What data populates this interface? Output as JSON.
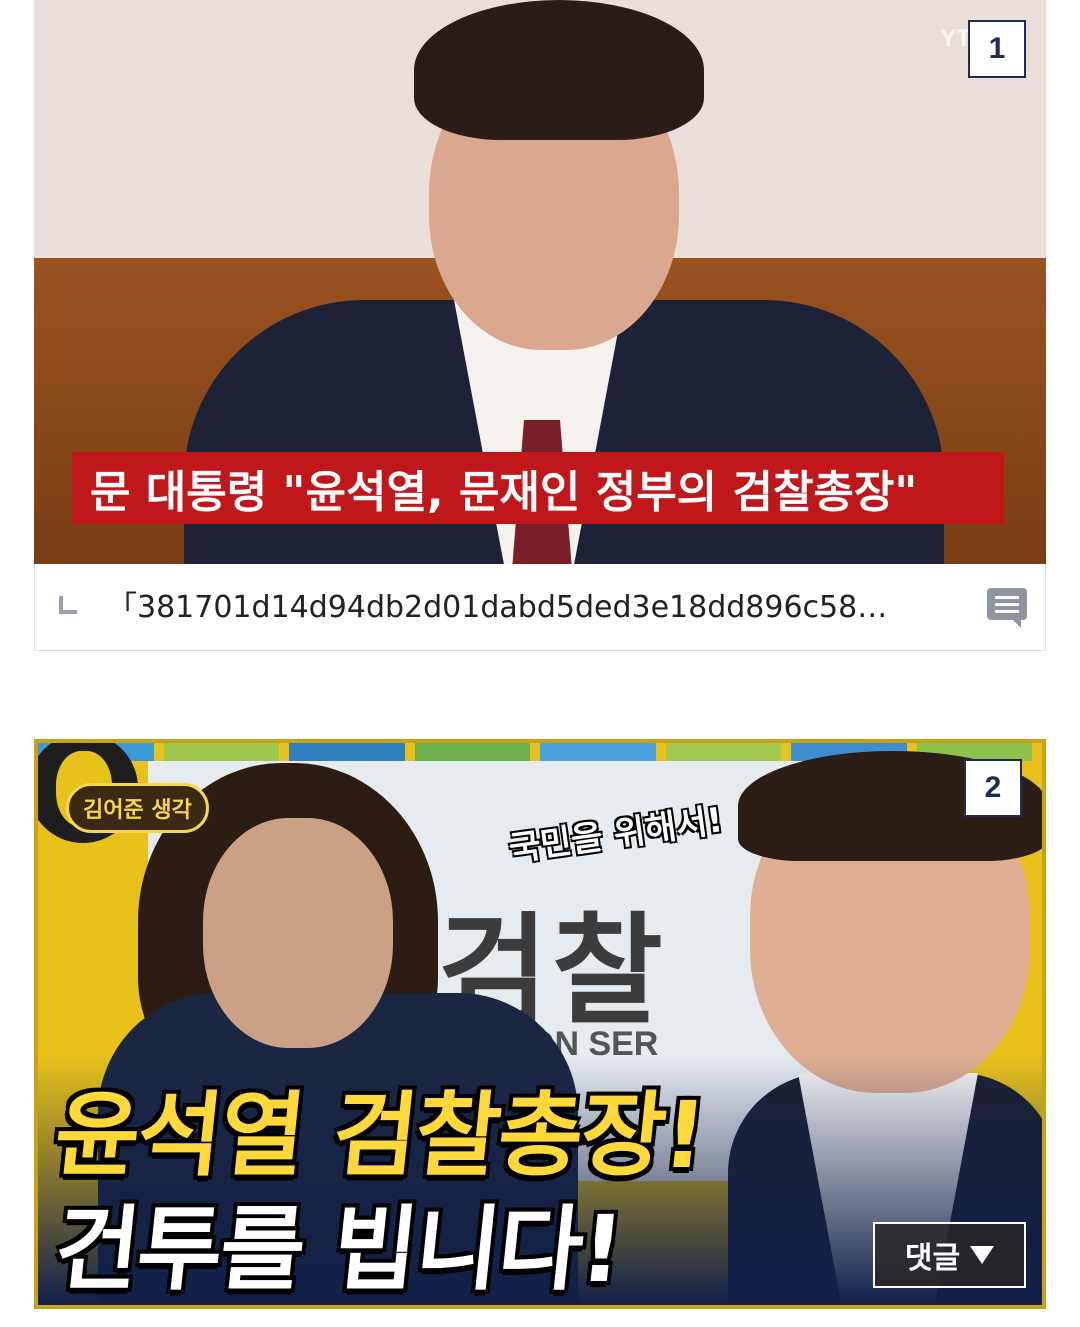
{
  "posts": [
    {
      "number": "1",
      "watermark": "YT",
      "banner_text": "문 대통령 \"윤석열, 문재인 정부의 검찰총장\"",
      "caption": "「381701d14d94db2d01dabd5ded3e18dd896c58…"
    },
    {
      "number": "2",
      "logo_text": "김어준 생각",
      "speech_text": "국민을 위해서!",
      "backdrop_word": "검찰",
      "backdrop_sub": "ON SER",
      "headline_line1": "윤석열 검찰총장!",
      "headline_line2": "건투를 빕니다!"
    }
  ],
  "comment_toggle": {
    "label": "댓글"
  },
  "colors": {
    "badge_border": "#1f2a5a",
    "news_banner": "#c0171b",
    "headline_yellow": "#ffd83a",
    "frame_yellow": "#e8c21a"
  },
  "stripe_colors": [
    "#3a9bd6",
    "#9cc74a",
    "#2f7fc1",
    "#6ab04c",
    "#4aa3df",
    "#a3c64f",
    "#3d8ed0",
    "#8fc24a"
  ]
}
